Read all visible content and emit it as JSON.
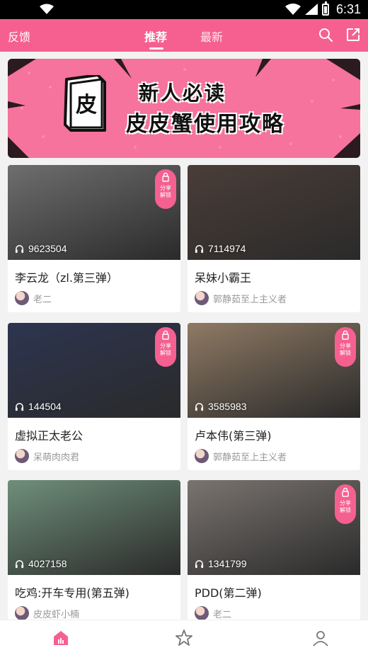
{
  "status_bar": {
    "time": "6:31"
  },
  "header": {
    "feedback_label": "反馈",
    "tabs": [
      {
        "label": "推荐",
        "active": true
      },
      {
        "label": "最新",
        "active": false
      }
    ],
    "accent_color": "#f56090"
  },
  "banner": {
    "line1": "新人必读",
    "line2": "皮皮蟹使用攻略",
    "book_char": "皮"
  },
  "lock": {
    "label_top": "分享",
    "label_bottom": "解锁"
  },
  "cards": [
    {
      "title": "李云龙（zl.第三弹）",
      "plays": "9623504",
      "author": "老二",
      "locked": true,
      "thumb_color": "#6e6e6e"
    },
    {
      "title": "呆妹小霸王",
      "plays": "7114974",
      "author": "郭静茹至上主义者",
      "locked": false,
      "thumb_color": "#4a3d38"
    },
    {
      "title": "虚拟正太老公",
      "plays": "144504",
      "author": "呆萌肉肉君",
      "locked": true,
      "thumb_color": "#2d3550"
    },
    {
      "title": "卢本伟(第三弹)",
      "plays": "3585983",
      "author": "郭静茹至上主义者",
      "locked": true,
      "thumb_color": "#8f7a64"
    },
    {
      "title": "吃鸡:开车专用(第五弹)",
      "plays": "4027158",
      "author": "皮皮虾小楠",
      "locked": false,
      "thumb_color": "#6f8f7a"
    },
    {
      "title": "PDD(第二弹)",
      "plays": "1341799",
      "author": "老二",
      "locked": true,
      "thumb_color": "#7a7470"
    }
  ],
  "bottom_nav": [
    {
      "icon": "home-icon",
      "active": true
    },
    {
      "icon": "star-icon",
      "active": false
    },
    {
      "icon": "profile-icon",
      "active": false
    }
  ]
}
